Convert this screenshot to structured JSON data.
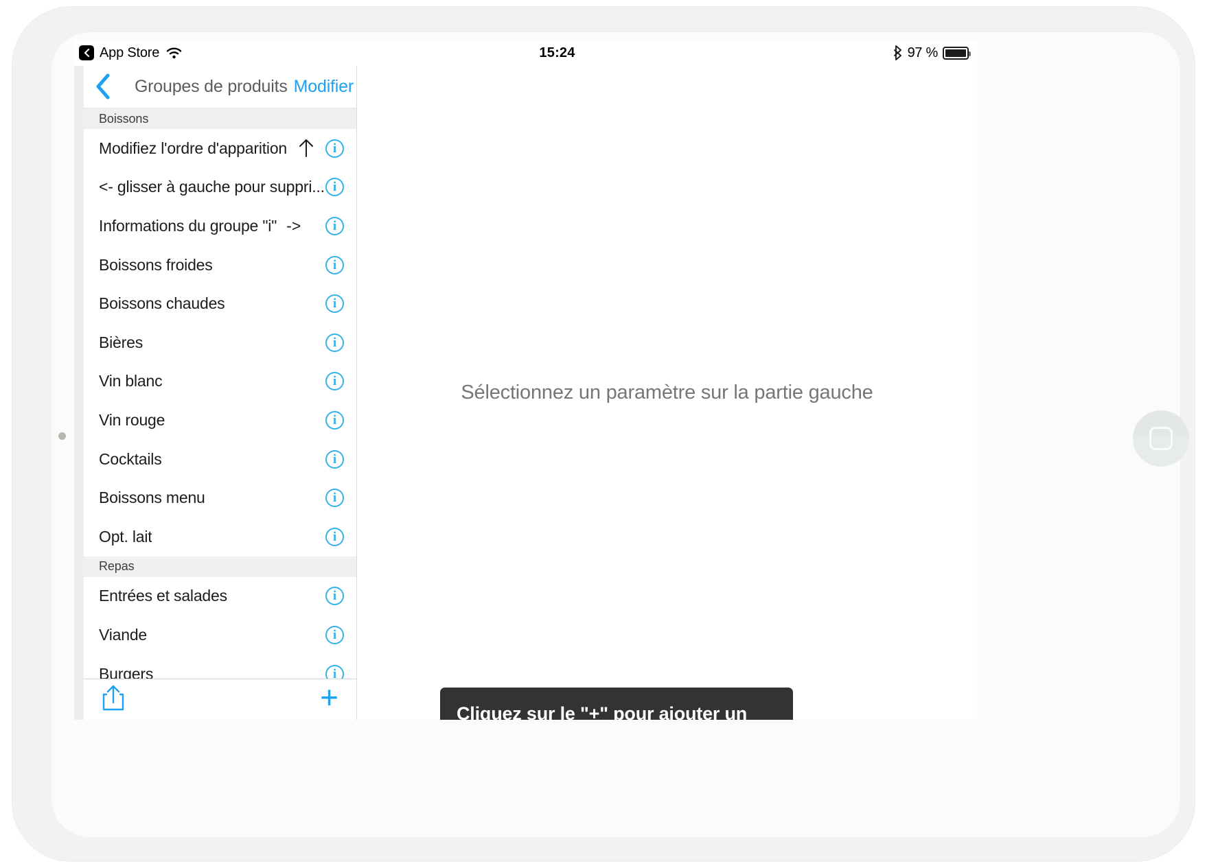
{
  "status_bar": {
    "back_chip_icon": "chevron-left-icon",
    "app_name": "App Store",
    "wifi_icon": "wifi-icon",
    "time": "15:24",
    "bluetooth_icon": "bluetooth-icon",
    "battery_percent": "97 %",
    "battery_icon": "battery-full-icon"
  },
  "nav": {
    "back_icon": "chevron-left-icon",
    "title": "Groupes de produits",
    "edit_label": "Modifier"
  },
  "sections": [
    {
      "header": "Boissons",
      "rows": [
        {
          "label": "Modifiez l'ordre d'apparition",
          "hint": "",
          "trailing_icon": "arrow-up-icon",
          "info_icon": "info-circle-icon",
          "info_label": "i"
        },
        {
          "label": "<- glisser à gauche pour suppri...",
          "hint": "",
          "trailing_icon": "",
          "info_icon": "info-circle-icon",
          "info_label": "i"
        },
        {
          "label": "Informations du groupe \"i\"",
          "hint": "->",
          "trailing_icon": "",
          "info_icon": "info-circle-icon",
          "info_label": "i"
        },
        {
          "label": "Boissons froides",
          "hint": "",
          "trailing_icon": "",
          "info_icon": "info-circle-icon",
          "info_label": "i"
        },
        {
          "label": "Boissons chaudes",
          "hint": "",
          "trailing_icon": "",
          "info_icon": "info-circle-icon",
          "info_label": "i"
        },
        {
          "label": "Bières",
          "hint": "",
          "trailing_icon": "",
          "info_icon": "info-circle-icon",
          "info_label": "i"
        },
        {
          "label": "Vin blanc",
          "hint": "",
          "trailing_icon": "",
          "info_icon": "info-circle-icon",
          "info_label": "i"
        },
        {
          "label": "Vin rouge",
          "hint": "",
          "trailing_icon": "",
          "info_icon": "info-circle-icon",
          "info_label": "i"
        },
        {
          "label": "Cocktails",
          "hint": "",
          "trailing_icon": "",
          "info_icon": "info-circle-icon",
          "info_label": "i"
        },
        {
          "label": "Boissons menu",
          "hint": "",
          "trailing_icon": "",
          "info_icon": "info-circle-icon",
          "info_label": "i"
        },
        {
          "label": "Opt. lait",
          "hint": "",
          "trailing_icon": "",
          "info_icon": "info-circle-icon",
          "info_label": "i"
        }
      ]
    },
    {
      "header": "Repas",
      "rows": [
        {
          "label": "Entrées et salades",
          "hint": "",
          "trailing_icon": "",
          "info_icon": "info-circle-icon",
          "info_label": "i"
        },
        {
          "label": "Viande",
          "hint": "",
          "trailing_icon": "",
          "info_icon": "info-circle-icon",
          "info_label": "i"
        },
        {
          "label": "Burgers",
          "hint": "",
          "trailing_icon": "",
          "info_icon": "info-circle-icon",
          "info_label": "i"
        }
      ]
    }
  ],
  "toolbar": {
    "share_icon": "share-icon",
    "add_label": "+"
  },
  "detail": {
    "placeholder_text": "Sélectionnez un paramètre sur la partie gauche"
  },
  "tooltip": {
    "text": "Cliquez sur le \"+\" pour ajouter un groupe de produit"
  },
  "device": {
    "home_button_icon": "home-square-icon",
    "front_camera_icon": "camera-dot-icon"
  },
  "colors": {
    "accent_blue": "#1da1f2",
    "info_blue": "#36b1e8",
    "tooltip_bg": "#333333",
    "section_header_bg": "#f1f0ee",
    "detail_text": "#767676"
  }
}
